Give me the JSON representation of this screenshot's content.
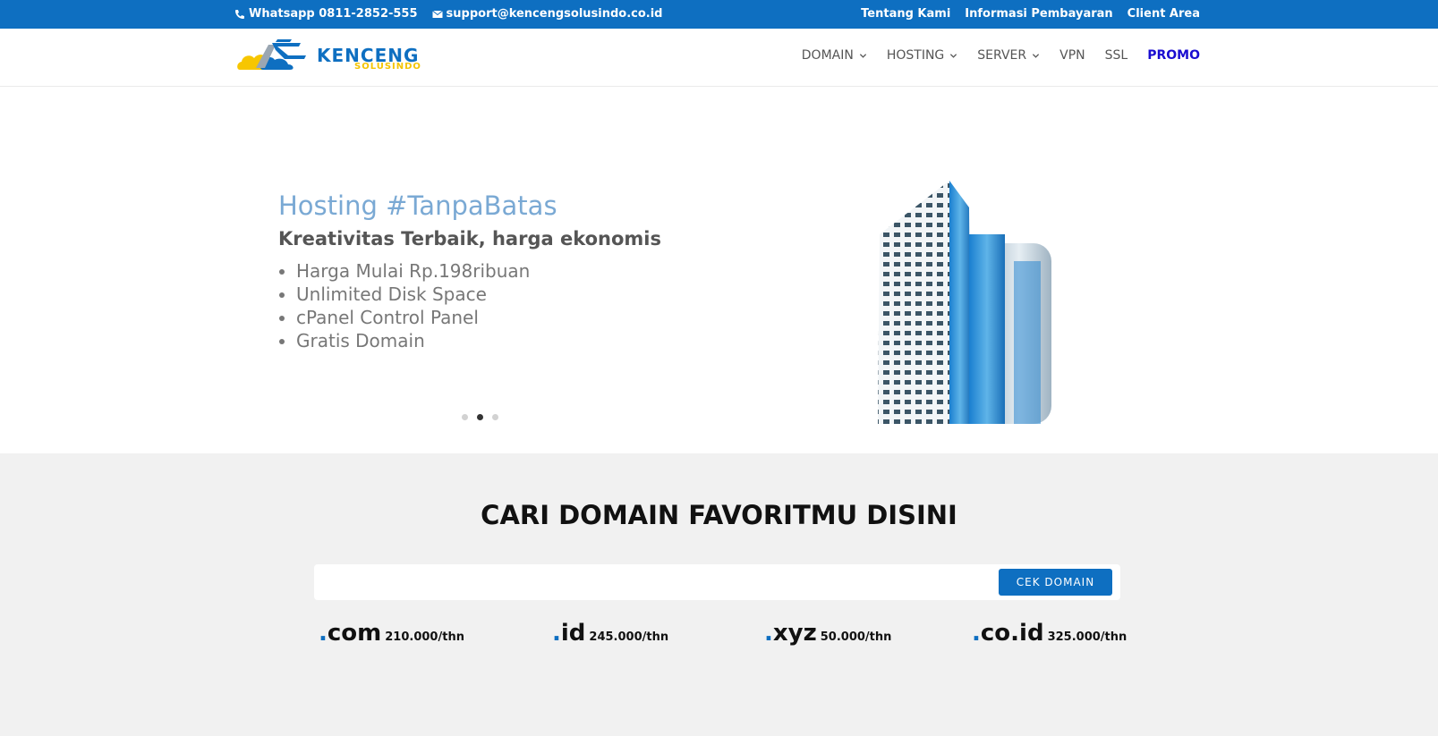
{
  "topbar": {
    "whatsapp": "Whatsapp 0811-2852-555",
    "email": "support@kencengsolusindo.co.id",
    "links": [
      "Tentang Kami",
      "Informasi Pembayaran",
      "Client Area"
    ]
  },
  "logo": {
    "brand": "KENCENG",
    "sub": "SOLUSINDO"
  },
  "nav": {
    "items": [
      {
        "label": "DOMAIN",
        "dropdown": true
      },
      {
        "label": "HOSTING",
        "dropdown": true
      },
      {
        "label": "SERVER",
        "dropdown": true
      },
      {
        "label": "VPN",
        "dropdown": false
      },
      {
        "label": "SSL",
        "dropdown": false
      },
      {
        "label": "PROMO",
        "dropdown": false
      }
    ]
  },
  "hero": {
    "title": "Hosting #TanpaBatas",
    "subtitle": "Kreativitas Terbaik, harga ekonomis",
    "features": [
      "Harga Mulai Rp.198ribuan",
      "Unlimited Disk Space",
      "cPanel Control Panel",
      "Gratis Domain"
    ],
    "slide_count": 3,
    "active_slide": 2
  },
  "domain": {
    "heading": "CARI DOMAIN FAVORITMU DISINI",
    "search_placeholder": "",
    "button_label": "CEK DOMAIN",
    "prices": [
      {
        "ext": "com",
        "price": "210.000/thn"
      },
      {
        "ext": "id",
        "price": "245.000/thn"
      },
      {
        "ext": "xyz",
        "price": "50.000/thn"
      },
      {
        "ext": "co.id",
        "price": "325.000/thn"
      }
    ]
  },
  "colors": {
    "primary": "#0e6fc1",
    "accent_yellow": "#f4c400",
    "promo": "#1a0dd1",
    "hero_title": "#7aa9d4"
  }
}
